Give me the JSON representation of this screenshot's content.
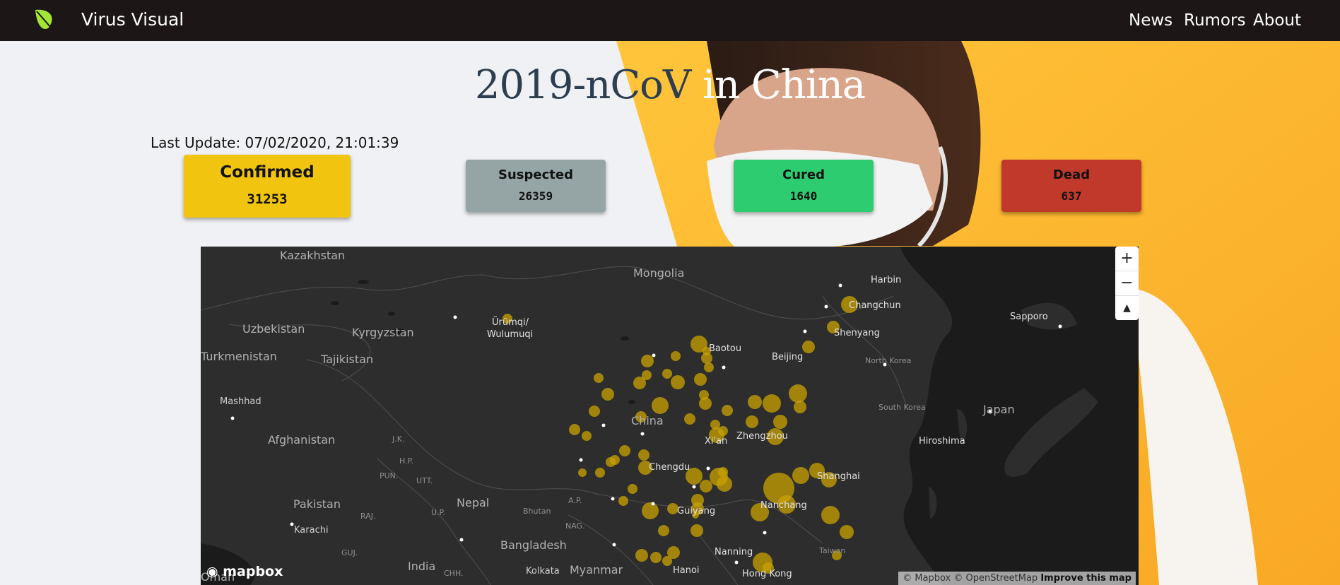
{
  "nav": {
    "brand": "Virus Visual",
    "links": [
      "News",
      "Rumors",
      "About"
    ],
    "accent": "#a3e635"
  },
  "hero": {
    "title_dark": "2019-nCoV",
    "title_light": " in China",
    "last_update": "Last Update: 07/02/2020, 21:01:39"
  },
  "stats": [
    {
      "label": "Confirmed",
      "value": "31253",
      "color": "#f1c40f"
    },
    {
      "label": "Suspected",
      "value": "26359",
      "color": "#95a5a6"
    },
    {
      "label": "Cured",
      "value": "1640",
      "color": "#2ecc71"
    },
    {
      "label": "Dead",
      "value": "637",
      "color": "#c0392b"
    }
  ],
  "map": {
    "controls": {
      "zoom_in": "+",
      "zoom_out": "−",
      "compass": "▲"
    },
    "logo": "mapbox",
    "attribution": "© Mapbox © OpenStreetMap",
    "improve": "Improve this map",
    "bubble_color": "#c9a100",
    "labels": {
      "kazakhstan": "Kazakhstan",
      "mongolia": "Mongolia",
      "uzbekistan": "Uzbekistan",
      "kyrgyzstan": "Kyrgyzstan",
      "turkmenistan": "Turkmenistan",
      "tajikistan": "Tajikistan",
      "mashhad": "Mashhad",
      "afghanistan": "Afghanistan",
      "pakistan": "Pakistan",
      "karachi": "Karachi",
      "india": "India",
      "nepal": "Nepal",
      "bhutan": "Bhutan",
      "bangladesh": "Bangladesh",
      "kolkata": "Kolkata",
      "myanmar": "Myanmar",
      "oman": "Oman",
      "urumqi": "Ürümqi/",
      "wulumuqi": "Wulumuqi",
      "baotou": "Baotou",
      "beijing": "Beijing",
      "china": "China",
      "xian": "Xi'an",
      "zhengzhou": "Zhengzhou",
      "chengdu": "Chengdu",
      "guiyang": "Guiyang",
      "nanning": "Nanning",
      "hanoi": "Hanoi",
      "hongkong": "Hong Kong",
      "nanchang": "Nanchang",
      "shanghai": "Shanghai",
      "taiwan": "Taiwan",
      "harbin": "Harbin",
      "changchun": "Changchun",
      "shenyang": "Shenyang",
      "northkorea": "North Korea",
      "southkorea": "South Korea",
      "japan": "Japan",
      "sapporo": "Sapporo",
      "hiroshima": "Hiroshima",
      "jk": "J.K.",
      "hp": "H.P.",
      "pun": "PUN.",
      "utt": "UTT.",
      "raj": "RAJ.",
      "up": "U.P.",
      "ap": "A.P.",
      "nag": "NAG.",
      "guj": "GUJ.",
      "chh": "CHH."
    }
  }
}
